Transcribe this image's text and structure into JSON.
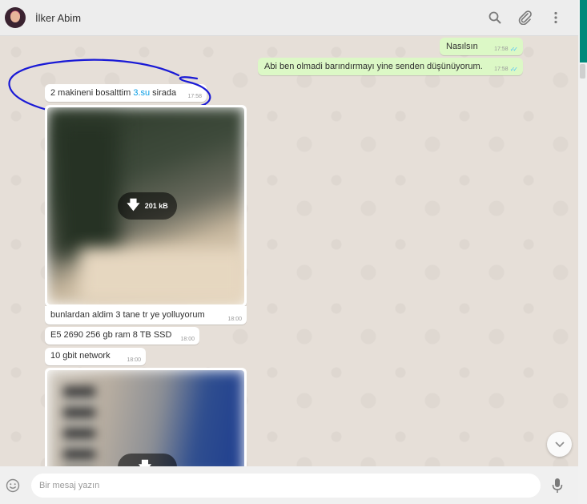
{
  "header": {
    "contact_name": "İlker Abim",
    "icons": [
      "search-icon",
      "attach-icon",
      "menu-icon"
    ]
  },
  "messages": [
    {
      "direction": "out",
      "text": "Nasılsın",
      "time": "17:58",
      "status": "read"
    },
    {
      "direction": "out",
      "text": "Abi ben olmadi barındırmayı yine senden düşünüyorum.",
      "time": "17:58",
      "status": "read"
    },
    {
      "direction": "in",
      "text_before": "2 makineni bosalttim ",
      "link": "3.su",
      "text_after": " sirada",
      "time": "17:58"
    },
    {
      "direction": "in",
      "type": "image",
      "download_size": "201 kB"
    },
    {
      "direction": "in",
      "text": "bunlardan aldim 3 tane tr ye yolluyorum",
      "time": "18:00"
    },
    {
      "direction": "in",
      "text": "E5 2690 256 gb ram 8 TB SSD",
      "time": "18:00"
    },
    {
      "direction": "in",
      "text": "10 gbit network",
      "time": "18:00"
    },
    {
      "direction": "in",
      "type": "image",
      "download_size": ""
    }
  ],
  "composer": {
    "placeholder": "Bir mesaj yazın"
  },
  "colors": {
    "outgoing_bubble": "#dcf8c6",
    "incoming_bubble": "#ffffff",
    "annotation_stroke": "#1a1ad6",
    "link": "#039be5",
    "read_tick": "#4fc3f7",
    "accent": "#00897b"
  }
}
